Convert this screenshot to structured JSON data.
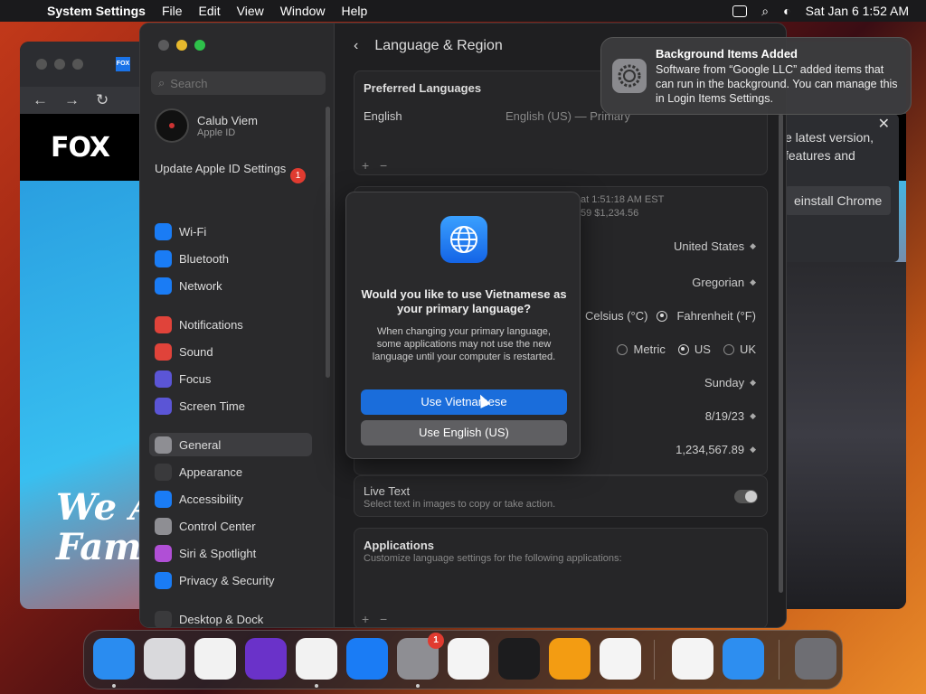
{
  "menubar": {
    "app_name": "System Settings",
    "menus": [
      "File",
      "Edit",
      "View",
      "Window",
      "Help"
    ],
    "datetime": "Sat Jan 6  1:52 AM"
  },
  "browser": {
    "tab_icon_label": "FOX",
    "logo": "FOX",
    "hero_text_line1": "We Ar",
    "hero_text_line2": "Fam",
    "update_panel_text": "e latest version, features and",
    "update_panel_button": "einstall Chrome",
    "update_panel_close": "✕"
  },
  "settings": {
    "sidebar": {
      "search_placeholder": "Search",
      "user_name": "Calub Viem",
      "user_sub": "Apple ID",
      "update_label": "Update Apple ID Settings",
      "update_badge": "1",
      "items": [
        {
          "label": "Wi-Fi",
          "icon": "wifi-icon",
          "color": "#1a7cf5"
        },
        {
          "label": "Bluetooth",
          "icon": "bluetooth-icon",
          "color": "#1a7cf5"
        },
        {
          "label": "Network",
          "icon": "network-icon",
          "color": "#1a7cf5"
        },
        {
          "label": "Notifications",
          "icon": "bell-icon",
          "color": "#e0433a"
        },
        {
          "label": "Sound",
          "icon": "speaker-icon",
          "color": "#e0433a"
        },
        {
          "label": "Focus",
          "icon": "moon-icon",
          "color": "#5b55d6"
        },
        {
          "label": "Screen Time",
          "icon": "hourglass-icon",
          "color": "#5b55d6"
        },
        {
          "label": "General",
          "icon": "gear-icon",
          "color": "#8e8e93"
        },
        {
          "label": "Appearance",
          "icon": "appearance-icon",
          "color": "#3a3a3c"
        },
        {
          "label": "Accessibility",
          "icon": "accessibility-icon",
          "color": "#1a7cf5"
        },
        {
          "label": "Control Center",
          "icon": "control-center-icon",
          "color": "#8e8e93"
        },
        {
          "label": "Siri & Spotlight",
          "icon": "siri-icon",
          "color": "#b04fd6"
        },
        {
          "label": "Privacy & Security",
          "icon": "hand-icon",
          "color": "#1a7cf5"
        },
        {
          "label": "Desktop & Dock",
          "icon": "dock-icon",
          "color": "#3a3a3c"
        }
      ]
    },
    "content": {
      "title": "Language & Region",
      "preferred_languages_title": "Preferred Languages",
      "language": "English",
      "language_detail": "English (US) — Primary",
      "plus": "+",
      "minus": "−",
      "format_preview_time": "at 1:51:18 AM EST",
      "format_preview_num": "59    $1,234.56",
      "region": "United States",
      "calendar": "Gregorian",
      "temp_celsius": "Celsius (°C)",
      "temp_fahrenheit": "Fahrenheit (°F)",
      "measure_metric": "Metric",
      "measure_us": "US",
      "measure_uk": "UK",
      "first_day": "Sunday",
      "date_format": "8/19/23",
      "number_format": "1,234,567.89",
      "live_text_title": "Live Text",
      "live_text_sub": "Select text in images to copy or take action.",
      "applications_title": "Applications",
      "applications_sub": "Customize language settings for the following applications:"
    }
  },
  "dialog": {
    "title": "Would you like to use Vietnamese as your primary language?",
    "body": "When changing your primary language, some applications may not use the new language until your computer is restarted.",
    "primary_button": "Use Vietnamese",
    "secondary_button": "Use English (US)"
  },
  "notification": {
    "title": "Background Items Added",
    "body": "Software from “Google LLC” added items that can run in the background. You can manage this in Login Items Settings."
  },
  "dock": {
    "apps": [
      {
        "name": "Finder",
        "icon": "finder-icon",
        "color": "#2a8cf0",
        "running": true
      },
      {
        "name": "Launchpad",
        "icon": "launchpad-icon",
        "color": "#d9d9dc",
        "running": false
      },
      {
        "name": "Safari",
        "icon": "safari-icon",
        "color": "#f2f2f2",
        "running": false
      },
      {
        "name": "Firefox",
        "icon": "firefox-icon",
        "color": "#6a32c9",
        "running": false
      },
      {
        "name": "Google Chrome",
        "icon": "chrome-icon",
        "color": "#f2f2f2",
        "running": true
      },
      {
        "name": "App Store",
        "icon": "app-store-icon",
        "color": "#1a7cf5",
        "running": false
      },
      {
        "name": "System Settings",
        "icon": "system-settings-icon",
        "color": "#8e8e93",
        "running": true,
        "badge": "1"
      },
      {
        "name": "TextEdit",
        "icon": "textedit-icon",
        "color": "#f4f4f4",
        "running": false
      },
      {
        "name": "Terminal",
        "icon": "terminal-icon",
        "color": "#1c1c1e",
        "running": false
      },
      {
        "name": "GarageBand",
        "icon": "garageband-icon",
        "color": "#f39c12",
        "running": false
      },
      {
        "name": "Visual Studio Code",
        "icon": "vscode-icon",
        "color": "#f4f4f4",
        "running": false
      },
      {
        "name": "Visual Studio",
        "icon": "visual-studio-icon",
        "color": "#f4f4f4",
        "running": false
      },
      {
        "name": "Weather",
        "icon": "weather-icon",
        "color": "#2d8ef0",
        "running": false
      },
      {
        "name": "Trash",
        "icon": "trash-icon",
        "color": "#6e6e73",
        "running": false
      }
    ]
  }
}
